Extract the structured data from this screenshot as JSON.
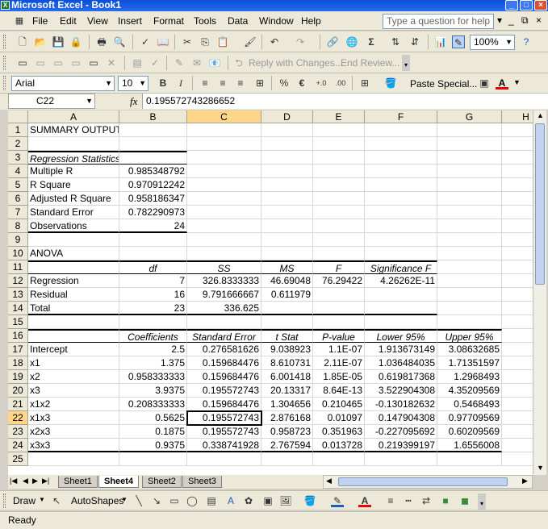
{
  "window": {
    "title": "Microsoft Excel - Book1"
  },
  "menu": [
    "File",
    "Edit",
    "View",
    "Insert",
    "Format",
    "Tools",
    "Data",
    "Window",
    "Help"
  ],
  "help_placeholder": "Type a question for help",
  "toolbar": {
    "zoom": "100%",
    "reply_label": "Reply with Changes...",
    "end_review_label": "End Review..."
  },
  "format": {
    "font": "Arial",
    "size": "10",
    "paste_special": "Paste Special..."
  },
  "formula": {
    "name_box": "C22",
    "fx": "fx",
    "value": "0.195572743286652"
  },
  "columns": [
    "A",
    "B",
    "C",
    "D",
    "E",
    "F",
    "G",
    "H"
  ],
  "rows": [
    "1",
    "2",
    "3",
    "4",
    "5",
    "6",
    "7",
    "8",
    "9",
    "10",
    "11",
    "12",
    "13",
    "14",
    "15",
    "16",
    "17",
    "18",
    "19",
    "20",
    "21",
    "22",
    "23",
    "24",
    "25"
  ],
  "cells": {
    "r1": {
      "a": "SUMMARY OUTPUT"
    },
    "r3": {
      "a": "Regression Statistics"
    },
    "r4": {
      "a": "Multiple R",
      "b": "0.985348792"
    },
    "r5": {
      "a": "R Square",
      "b": "0.970912242"
    },
    "r6": {
      "a": "Adjusted R Square",
      "b": "0.958186347"
    },
    "r7": {
      "a": "Standard Error",
      "b": "0.782290973"
    },
    "r8": {
      "a": "Observations",
      "b": "24"
    },
    "r10": {
      "a": "ANOVA"
    },
    "r11": {
      "b": "df",
      "c": "SS",
      "d": "MS",
      "e": "F",
      "f": "Significance F"
    },
    "r12": {
      "a": "Regression",
      "b": "7",
      "c": "326.8333333",
      "d": "46.69048",
      "e": "76.29422",
      "f": "4.26262E-11"
    },
    "r13": {
      "a": "Residual",
      "b": "16",
      "c": "9.791666667",
      "d": "0.611979"
    },
    "r14": {
      "a": "Total",
      "b": "23",
      "c": "336.625"
    },
    "r16": {
      "b": "Coefficients",
      "c": "Standard Error",
      "d": "t Stat",
      "e": "P-value",
      "f": "Lower 95%",
      "g": "Upper 95%"
    },
    "r17": {
      "a": "Intercept",
      "b": "2.5",
      "c": "0.276581626",
      "d": "9.038923",
      "e": "1.1E-07",
      "f": "1.913673149",
      "g": "3.08632685"
    },
    "r18": {
      "a": "x1",
      "b": "1.375",
      "c": "0.159684476",
      "d": "8.610731",
      "e": "2.11E-07",
      "f": "1.036484035",
      "g": "1.71351597"
    },
    "r19": {
      "a": "x2",
      "b": "0.958333333",
      "c": "0.159684476",
      "d": "6.001418",
      "e": "1.85E-05",
      "f": "0.619817368",
      "g": "1.2968493"
    },
    "r20": {
      "a": "x3",
      "b": "3.9375",
      "c": "0.195572743",
      "d": "20.13317",
      "e": "8.64E-13",
      "f": "3.522904308",
      "g": "4.35209569"
    },
    "r21": {
      "a": "x1x2",
      "b": "0.208333333",
      "c": "0.159684476",
      "d": "1.304656",
      "e": "0.210465",
      "f": "-0.130182632",
      "g": "0.5468493"
    },
    "r22": {
      "a": "x1x3",
      "b": "0.5625",
      "c": "0.195572743",
      "d": "2.876168",
      "e": "0.01097",
      "f": "0.147904308",
      "g": "0.97709569"
    },
    "r23": {
      "a": "x2x3",
      "b": "0.1875",
      "c": "0.195572743",
      "d": "0.958723",
      "e": "0.351963",
      "f": "-0.227095692",
      "g": "0.60209569"
    },
    "r24": {
      "a": "x3x3",
      "b": "0.9375",
      "c": "0.338741928",
      "d": "2.767594",
      "e": "0.013728",
      "f": "0.219399197",
      "g": "1.6556008"
    }
  },
  "sheets": [
    "Sheet1",
    "Sheet4",
    "Sheet2",
    "Sheet3"
  ],
  "active_sheet": "Sheet4",
  "drawing": {
    "draw_label": "Draw",
    "autoshapes_label": "AutoShapes"
  },
  "status": {
    "text": "Ready"
  },
  "colors": {
    "title_bar": "#0a4fd8",
    "selection_header": "#ffd58a"
  }
}
